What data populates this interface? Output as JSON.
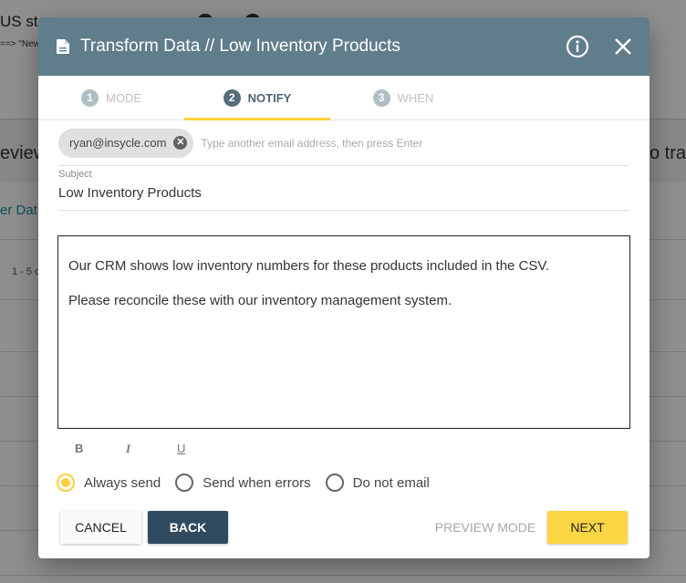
{
  "background": {
    "title_fragment": "US sta",
    "subtitle_fragment": "==> \"New",
    "left_heading_fragment": "eview",
    "right_heading_fragment": "o tra",
    "link_fragment": "er Dat",
    "count_fragment": "1 - 5 o"
  },
  "modal": {
    "title": "Transform Data // Low Inventory Products",
    "icons": {
      "document": "document-icon",
      "info": "info-icon",
      "close": "close-icon"
    },
    "steps": [
      {
        "number": "1",
        "label": "MODE",
        "active": false
      },
      {
        "number": "2",
        "label": "NOTIFY",
        "active": true
      },
      {
        "number": "3",
        "label": "WHEN",
        "active": false
      }
    ],
    "recipients": {
      "chips": [
        "ryan@insycle.com"
      ],
      "input_value": "",
      "placeholder": "Type another email address, then press Enter"
    },
    "subject": {
      "label": "Subject",
      "value": "Low Inventory Products"
    },
    "body": {
      "paragraphs": [
        "Our CRM shows low inventory numbers for these products included in the CSV.",
        "Please reconcile these with our inventory management system."
      ]
    },
    "format_buttons": [
      "B",
      "I",
      "U"
    ],
    "send_options": [
      {
        "label": "Always send",
        "checked": true
      },
      {
        "label": "Send when errors",
        "checked": false
      },
      {
        "label": "Do not email",
        "checked": false
      }
    ],
    "footer": {
      "cancel_label": "CANCEL",
      "back_label": "BACK",
      "preview_label": "PREVIEW MODE",
      "next_label": "NEXT"
    }
  },
  "colors": {
    "header": "#607d8b",
    "accent": "#fdd03b",
    "back_button": "#304a60"
  }
}
